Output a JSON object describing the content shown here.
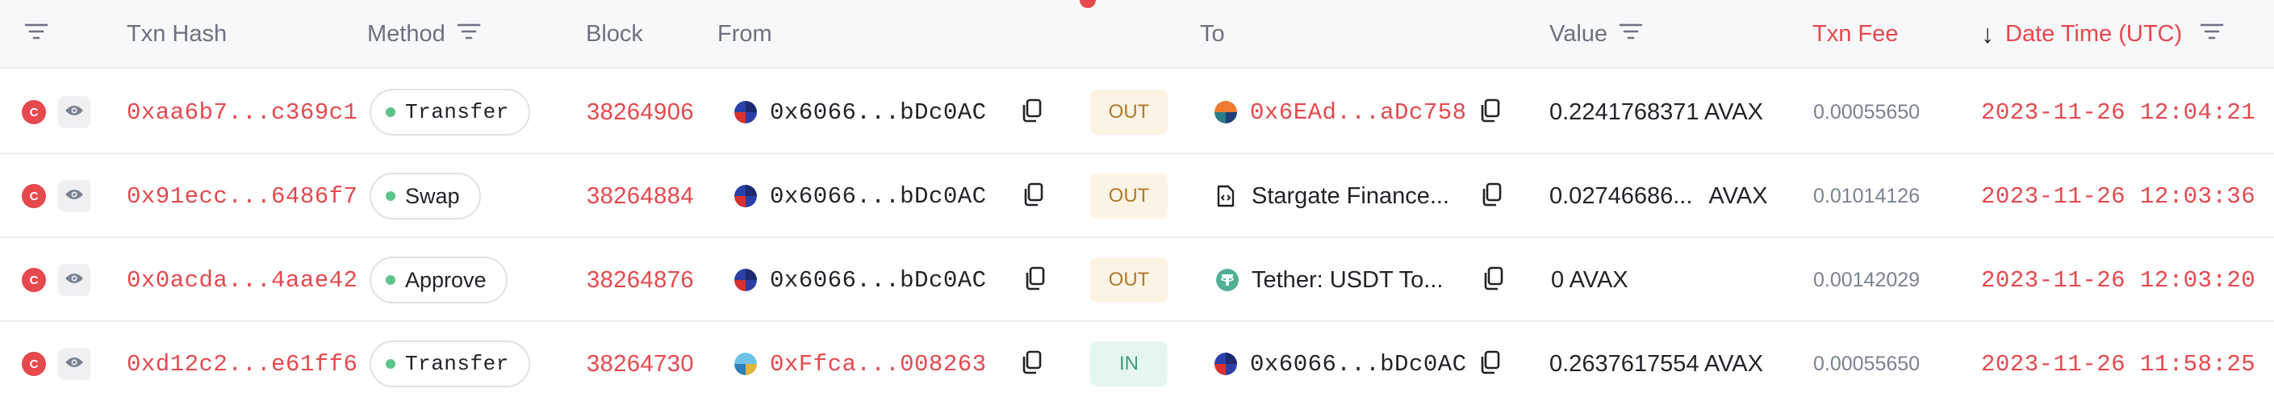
{
  "headers": {
    "txn_hash": "Txn Hash",
    "method": "Method",
    "block": "Block",
    "from": "From",
    "to": "To",
    "value": "Value",
    "txn_fee": "Txn Fee",
    "date_time": "Date Time (UTC)",
    "sort_arrow": "↓"
  },
  "colors": {
    "accent_red": "#e5484d",
    "method_dot_green": "#5cc486",
    "out_tag_bg": "#fbf3e4",
    "in_tag_bg": "#e5f6f0"
  },
  "rows": [
    {
      "badge": "C",
      "hash": "0xaa6b7...c369c1",
      "method": "Transfer",
      "block": "38264906",
      "from": "0x6066...bDc0AC",
      "direction": "OUT",
      "to": "0x6EAd...aDc758",
      "value": "0.2241768371 AVAX",
      "fee": "0.00055650",
      "datetime": "2023-11-26 12:04:21"
    },
    {
      "badge": "C",
      "hash": "0x91ecc...6486f7",
      "method": "Swap",
      "block": "38264884",
      "from": "0x6066...bDc0AC",
      "direction": "OUT",
      "to": "Stargate Finance...",
      "value_amount": "0.02746686...",
      "value_unit": "AVAX",
      "fee": "0.01014126",
      "datetime": "2023-11-26 12:03:36"
    },
    {
      "badge": "C",
      "hash": "0x0acda...4aae42",
      "method": "Approve",
      "block": "38264876",
      "from": "0x6066...bDc0AC",
      "direction": "OUT",
      "to": "Tether: USDT To...",
      "value": "0 AVAX",
      "fee": "0.00142029",
      "datetime": "2023-11-26 12:03:20"
    },
    {
      "badge": "C",
      "hash": "0xd12c2...e61ff6",
      "method": "Transfer",
      "block": "38264730",
      "from": "0xFfca...008263",
      "direction": "IN",
      "to": "0x6066...bDc0AC",
      "value": "0.2637617554 AVAX",
      "fee": "0.00055650",
      "datetime": "2023-11-26 11:58:25"
    }
  ]
}
